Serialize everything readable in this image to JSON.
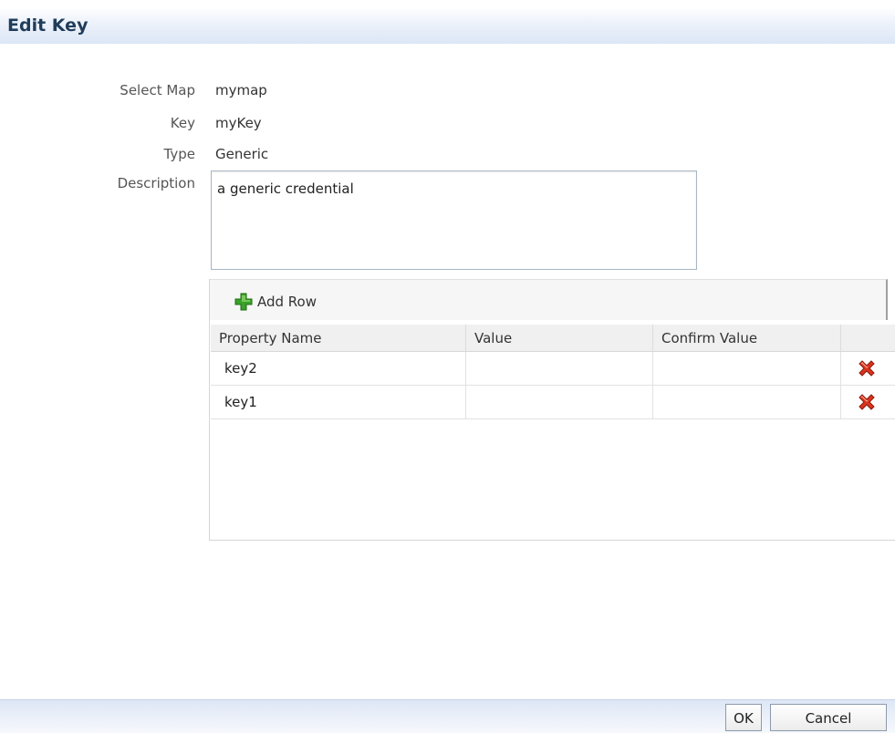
{
  "header": {
    "title": "Edit Key"
  },
  "form": {
    "select_map_label": "Select Map",
    "select_map_value": "mymap",
    "key_label": "Key",
    "key_value": "myKey",
    "type_label": "Type",
    "type_value": "Generic",
    "description_label": "Description",
    "description_value": "a generic credential"
  },
  "table": {
    "add_row_label": "Add Row",
    "add_row_icon": "green-plus-icon",
    "delete_icon": "red-x-icon",
    "columns": [
      "Property Name",
      "Value",
      "Confirm Value"
    ],
    "rows": [
      {
        "property_name": "key2",
        "value": "",
        "confirm_value": ""
      },
      {
        "property_name": "key1",
        "value": "",
        "confirm_value": ""
      }
    ]
  },
  "footer": {
    "ok_label": "OK",
    "cancel_label": "Cancel"
  },
  "colors": {
    "header_title": "#1f3d5a",
    "add_icon": "#3aa12a",
    "delete_icon": "#d9341f"
  }
}
